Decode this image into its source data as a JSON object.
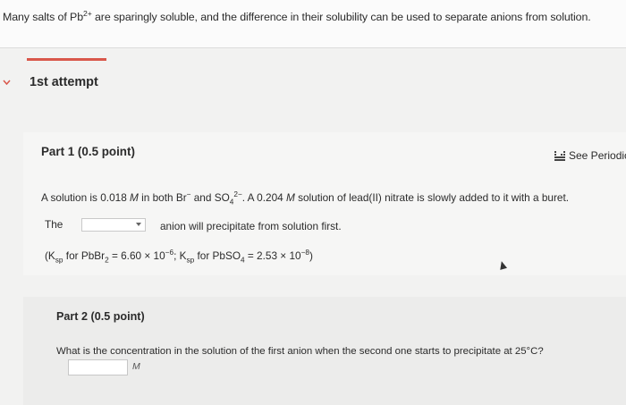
{
  "intro": {
    "text_before": "Many salts of Pb",
    "text_sup": "2+",
    "text_after": " are sparingly soluble, and the difference in their solubility can be used to separate anions from solution."
  },
  "attempt": {
    "label": "1st attempt"
  },
  "part1": {
    "title": "Part 1   (0.5 point)",
    "see_periodic": "See Periodic",
    "question": {
      "a": "A solution is 0.018 ",
      "m1": "M",
      "b": " in both Br",
      "b_sup": "−",
      "c": " and SO",
      "c_sub": "4",
      "c_sup": "2−",
      "d": ". A 0.204 ",
      "m2": "M",
      "e": " solution of lead(II) nitrate is slowly added to it with a buret."
    },
    "the_label": "The",
    "select_value": "",
    "after_select": "anion will precipitate from solution first.",
    "ksp": {
      "open": "(K",
      "sp1": "sp",
      "t1": " for PbBr",
      "sub1": "2",
      "t2": " = 6.60 × 10",
      "exp1": "−6",
      "t3": "; K",
      "sp2": "sp",
      "t4": " for PbSO",
      "sub2": "4",
      "t5": " = 2.53 × 10",
      "exp2": "−8",
      "close": ")"
    }
  },
  "part2": {
    "title": "Part 2   (0.5 point)",
    "question": "What is the concentration in the solution of the first anion when the second one starts to precipitate at 25°C?",
    "answer_value": "",
    "unit": "M"
  }
}
